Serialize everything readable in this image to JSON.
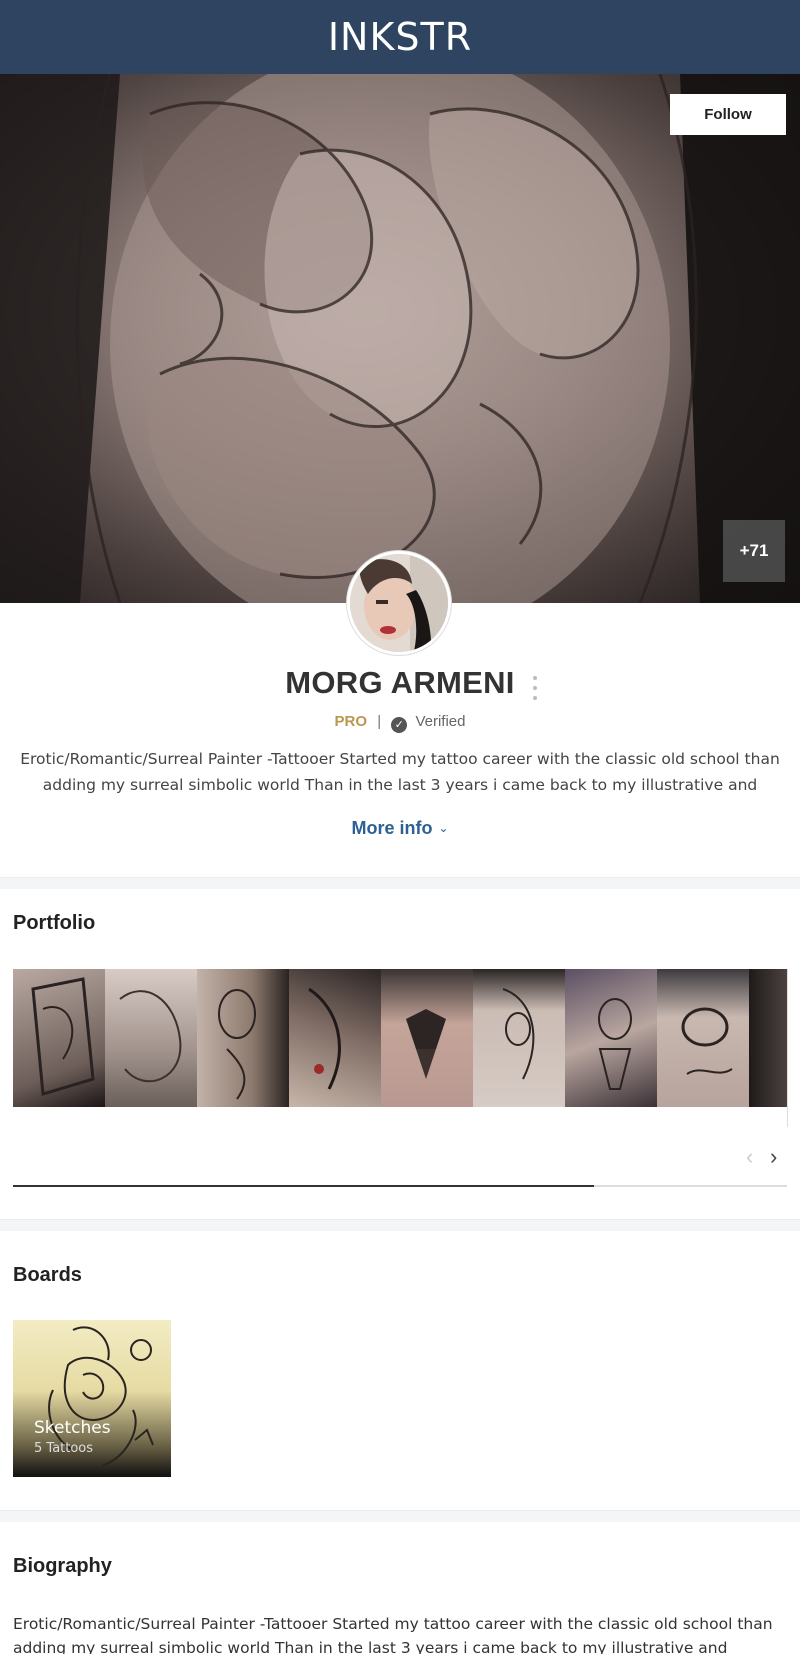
{
  "header": {
    "brand": "INKSTR"
  },
  "hero": {
    "follow_label": "Follow",
    "more_photos_label": "+71"
  },
  "profile": {
    "name": "MORG ARMENI",
    "pro_label": "PRO",
    "separator": "|",
    "verified_label": "Verified",
    "bio": "Erotic/Romantic/Surreal Painter -Tattooer Started my tattoo career with the classic old school than adding my surreal simbolic world Than in the last 3 years i came back to my illustrative and",
    "more_info_label": "More info",
    "more_info_icon": "chevron-down-icon"
  },
  "portfolio": {
    "title": "Portfolio",
    "thumbnail_count": 9,
    "scroll_progress": 0.75,
    "prev_icon": "chevron-left-icon",
    "next_icon": "chevron-right-icon"
  },
  "boards": {
    "title": "Boards",
    "items": [
      {
        "title": "Sketches",
        "count": "5 Tattoos"
      }
    ]
  },
  "biography": {
    "title": "Biography",
    "text": "Erotic/Romantic/Surreal Painter -Tattooer Started my tattoo career with the classic old school than adding my surreal simbolic world Than in the last 3 years i came back to my illustrative and"
  },
  "colors": {
    "header_bg": "#2e4460",
    "link": "#2f6093",
    "pro": "#b9974e"
  }
}
